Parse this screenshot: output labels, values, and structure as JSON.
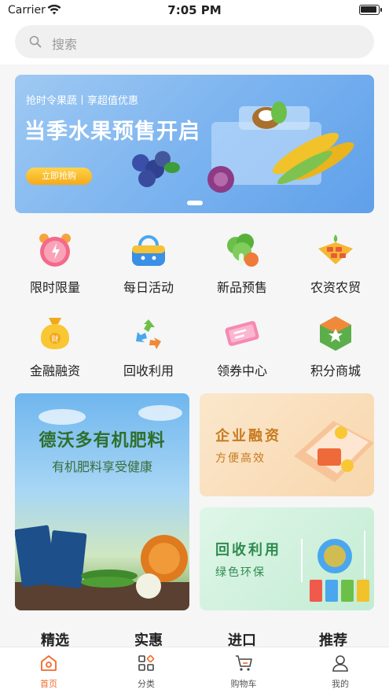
{
  "status_bar": {
    "carrier": "Carrier",
    "time": "7:05 PM"
  },
  "search": {
    "placeholder": "搜索"
  },
  "banner": {
    "subtitle": "抢时令果蔬丨享超值优惠",
    "headline": "当季水果预售开启",
    "cta": "立即抢购"
  },
  "categories": [
    {
      "label": "限时限量",
      "icon": "alarm-clock-icon"
    },
    {
      "label": "每日活动",
      "icon": "basket-icon"
    },
    {
      "label": "新品预售",
      "icon": "vegetables-icon"
    },
    {
      "label": "农资农贸",
      "icon": "seedling-tray-icon"
    },
    {
      "label": "金融融资",
      "icon": "money-bag-icon"
    },
    {
      "label": "回收利用",
      "icon": "recycle-icon"
    },
    {
      "label": "领券中心",
      "icon": "coupon-icon"
    },
    {
      "label": "积分商城",
      "icon": "star-shop-icon"
    }
  ],
  "promo_big": {
    "title": "德沃多有机肥料",
    "subtitle": "有机肥料享受健康"
  },
  "promo_finance": {
    "title": "企业融资",
    "subtitle": "方便高效"
  },
  "promo_recycle": {
    "title": "回收利用",
    "subtitle": "绿色环保"
  },
  "section_tabs": [
    "精选",
    "实惠",
    "进口",
    "推荐"
  ],
  "tab_bar": [
    {
      "label": "首页",
      "icon": "home-icon",
      "active": true
    },
    {
      "label": "分类",
      "icon": "category-icon",
      "active": false
    },
    {
      "label": "购物车",
      "icon": "cart-icon",
      "active": false
    },
    {
      "label": "我的",
      "icon": "profile-icon",
      "active": false
    }
  ],
  "colors": {
    "accent": "#f26a2a"
  }
}
